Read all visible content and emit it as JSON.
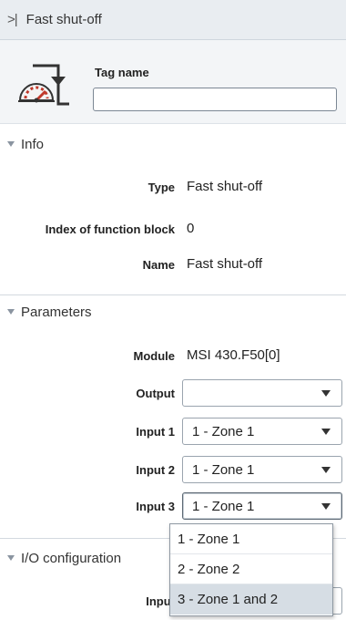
{
  "header": {
    "collapse_glyph": ">|",
    "title": "Fast shut-off"
  },
  "tag": {
    "icon": "fast-shut-off-gauge-icon",
    "label": "Tag name",
    "value": ""
  },
  "info": {
    "heading": "Info",
    "type_label": "Type",
    "type_value": "Fast shut-off",
    "index_label": "Index of function block",
    "index_value": "0",
    "name_label": "Name",
    "name_value": "Fast shut-off"
  },
  "parameters": {
    "heading": "Parameters",
    "module_label": "Module",
    "module_value": "MSI 430.F50[0]",
    "output_label": "Output",
    "output_value": "",
    "input1_label": "Input 1",
    "input1_value": "1 - Zone 1",
    "input2_label": "Input 2",
    "input2_value": "1 - Zone 1",
    "input3_label": "Input 3",
    "input3_value": "1 - Zone 1"
  },
  "io": {
    "heading": "I/O configuration",
    "input_label": "Input"
  },
  "dropdown": {
    "options": [
      "1 - Zone 1",
      "2 - Zone 2",
      "3 - Zone 1 and 2"
    ],
    "hovered_index": 2
  }
}
